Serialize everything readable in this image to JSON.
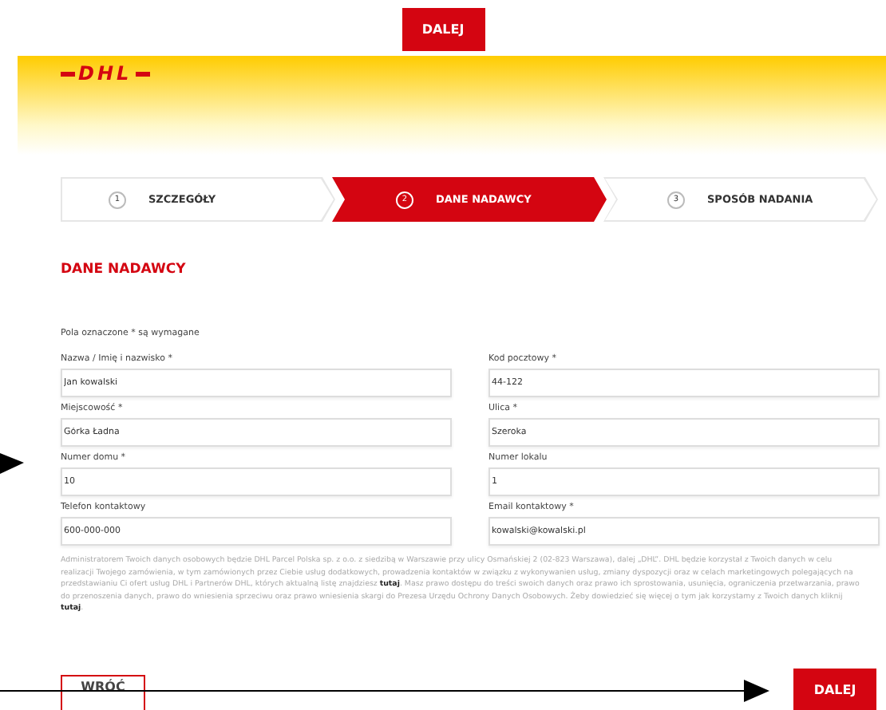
{
  "top_button": "DALEJ",
  "logo": "DHL",
  "steps": [
    {
      "number": "1",
      "label": "SZCZEGÓŁY",
      "selected": false
    },
    {
      "number": "2",
      "label": "DANE NADAWCY",
      "selected": true
    },
    {
      "number": "3",
      "label": "SPOSÓB NADANIA",
      "selected": false
    }
  ],
  "heading": "DANE NADAWCY",
  "required_note": "Pola oznaczone * są wymagane",
  "fields": [
    {
      "label": "Nazwa / Imię i nazwisko *",
      "value": "Jan kowalski"
    },
    {
      "label": "Kod pocztowy *",
      "value": "44-122"
    },
    {
      "label": "Miejscowość *",
      "value": "Górka Ładna"
    },
    {
      "label": "Ulica *",
      "value": "Szeroka"
    },
    {
      "label": "Numer domu *",
      "value": "10"
    },
    {
      "label": "Numer lokalu",
      "value": "1"
    },
    {
      "label": "Telefon kontaktowy",
      "value": "600-000-000"
    },
    {
      "label": "Email kontaktowy *",
      "value": "kowalski@kowalski.pl"
    }
  ],
  "privacy_notice": [
    {
      "kind": "text",
      "text": "Administratorem Twoich danych osobowych będzie DHL Parcel Polska sp. z o.o. z siedzibą w Warszawie przy ulicy Osmańskiej 2 (02-823 Warszawa), dalej „DHL”. DHL będzie korzystał z Twoich danych w celu realizacji Twojego zamówienia, w tym zamówionych przez Ciebie usług dodatkowych, prowadzenia kontaktów w związku z wykonywanien usług, zmiany dyspozycji oraz w celach marketingowych polegających na przedstawianiu Ci ofert usług DHL i Partnerów DHL, których aktualną listę znajdziesz "
    },
    {
      "kind": "link",
      "text": "tutaj"
    },
    {
      "kind": "text",
      "text": ". Masz prawo dostępu do treści swoich danych oraz prawo ich sprostowania, usunięcia, ograniczenia przetwarzania, prawo do przenoszenia danych, prawo do wniesienia sprzeciwu oraz prawo wniesienia skargi do Prezesa Urzędu Ochrony Danych Osobowych. Żeby dowiedzieć się więcej o tym jak korzystamy z Twoich danych kliknij "
    },
    {
      "kind": "link",
      "text": "tutaj"
    },
    {
      "kind": "text",
      "text": "."
    }
  ],
  "back_button": "WRÓĆ",
  "next_button": "DALEJ"
}
